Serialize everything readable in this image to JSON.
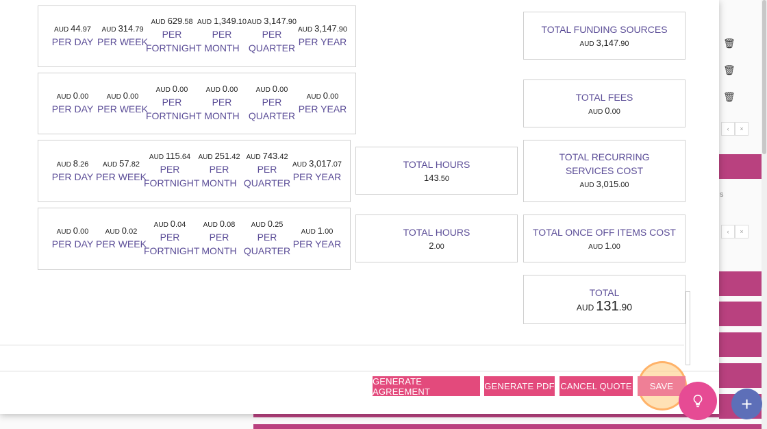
{
  "currency_label": "AUD",
  "rows": [
    {
      "cells": [
        {
          "whole": "44",
          "cents": ".97",
          "label": "PER DAY"
        },
        {
          "whole": "314",
          "cents": ".79",
          "label": "PER WEEK"
        },
        {
          "whole": "629",
          "cents": ".58",
          "label": "PER FORTNIGHT"
        },
        {
          "whole": "1,349",
          "cents": ".10",
          "label": "PER MONTH"
        },
        {
          "whole": "3,147",
          "cents": ".90",
          "label": "PER QUARTER"
        },
        {
          "whole": "3,147",
          "cents": ".90",
          "label": "PER YEAR"
        }
      ]
    },
    {
      "cells": [
        {
          "whole": "0",
          "cents": ".00",
          "label": "PER DAY"
        },
        {
          "whole": "0",
          "cents": ".00",
          "label": "PER WEEK"
        },
        {
          "whole": "0",
          "cents": ".00",
          "label": "PER FORTNIGHT"
        },
        {
          "whole": "0",
          "cents": ".00",
          "label": "PER MONTH"
        },
        {
          "whole": "0",
          "cents": ".00",
          "label": "PER QUARTER"
        },
        {
          "whole": "0",
          "cents": ".00",
          "label": "PER YEAR"
        }
      ]
    },
    {
      "cells": [
        {
          "whole": "8",
          "cents": ".26",
          "label": "PER DAY"
        },
        {
          "whole": "57",
          "cents": ".82",
          "label": "PER WEEK"
        },
        {
          "whole": "115",
          "cents": ".64",
          "label": "PER FORTNIGHT"
        },
        {
          "whole": "251",
          "cents": ".42",
          "label": "PER MONTH"
        },
        {
          "whole": "743",
          "cents": ".42",
          "label": "PER QUARTER"
        },
        {
          "whole": "3,017",
          "cents": ".07",
          "label": "PER YEAR"
        }
      ]
    },
    {
      "cells": [
        {
          "whole": "0",
          "cents": ".00",
          "label": "PER DAY"
        },
        {
          "whole": "0",
          "cents": ".02",
          "label": "PER WEEK"
        },
        {
          "whole": "0",
          "cents": ".04",
          "label": "PER FORTNIGHT"
        },
        {
          "whole": "0",
          "cents": ".08",
          "label": "PER MONTH"
        },
        {
          "whole": "0",
          "cents": ".25",
          "label": "PER QUARTER"
        },
        {
          "whole": "1",
          "cents": ".00",
          "label": "PER YEAR"
        }
      ]
    }
  ],
  "hours": [
    {
      "title": "TOTAL HOURS",
      "whole": "143",
      "cents": ".50"
    },
    {
      "title": "TOTAL HOURS",
      "whole": "2",
      "cents": ".00"
    }
  ],
  "totals": [
    {
      "title": "TOTAL FUNDING SOURCES",
      "whole": "3,147",
      "cents": ".90"
    },
    {
      "title": "TOTAL FEES",
      "whole": "0",
      "cents": ".00"
    },
    {
      "title": "TOTAL RECURRING SERVICES COST",
      "whole": "3,015",
      "cents": ".00"
    },
    {
      "title": "TOTAL ONCE OFF ITEMS COST",
      "whole": "1",
      "cents": ".00"
    },
    {
      "title": "TOTAL",
      "whole": "131",
      "cents": ".90"
    }
  ],
  "actions": {
    "generate_agreement": "GENERATE AGREEMENT",
    "generate_pdf": "GENERATE PDF",
    "cancel_quote": "CANCEL QUOTE",
    "save": "SAVE"
  },
  "background": {
    "pager_prev": "‹",
    "pager_close": "×",
    "hint_char": "s",
    "trash_icon": "trash-icon"
  },
  "fab": {
    "bulb_icon": "lightbulb-icon",
    "plus_label": "+"
  },
  "colors": {
    "accent_pink": "#e34a7c",
    "label_purple": "#5b4d97",
    "save_pink": "#ef7f96",
    "fab_blue": "#5d6fb8"
  }
}
